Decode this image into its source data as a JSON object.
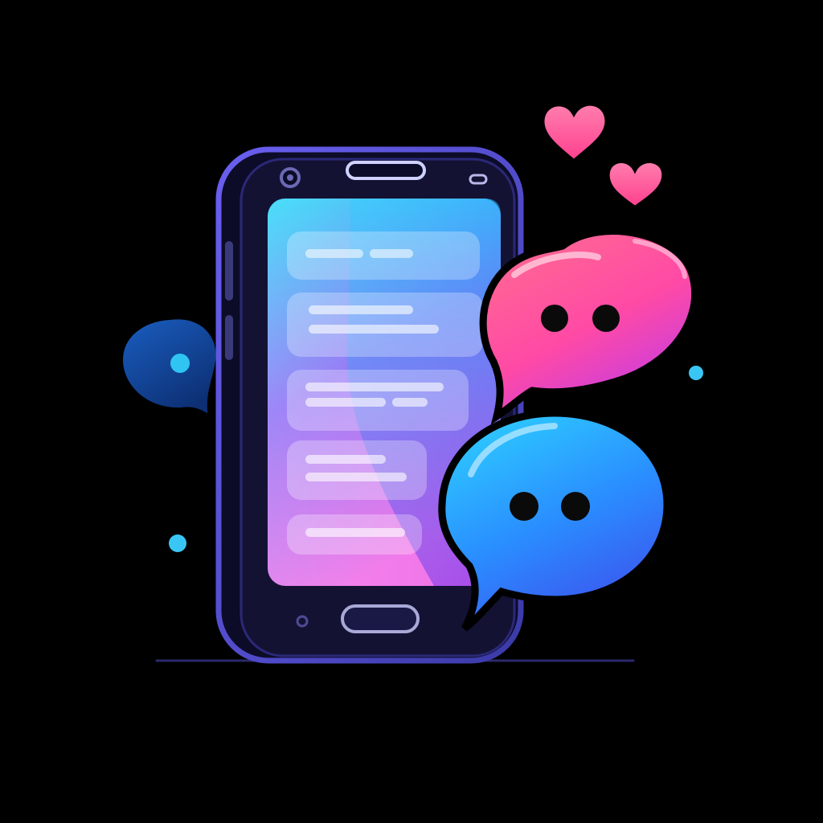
{
  "illustration": {
    "subject": "messaging-app",
    "icons": {
      "phone": "smartphone-icon",
      "pink_bubble": "chat-bubble-icon",
      "blue_bubble": "chat-bubble-icon",
      "small_bubble": "chat-bubble-icon",
      "heart_large": "heart-icon",
      "heart_small": "heart-icon"
    },
    "colors": {
      "background": "#000000",
      "phone_body": "#141233",
      "phone_frame": "#5a4fd0",
      "screen_top": "#22d8f7",
      "screen_mid": "#8a6cf5",
      "screen_bottom": "#f06fe8",
      "bubble_pink": "#ff4fa3",
      "bubble_blue": "#2a9cff",
      "bubble_small": "#114a9a",
      "heart": "#ff4f9a",
      "sparkle": "#39c6f5"
    },
    "message_rows": 5
  }
}
